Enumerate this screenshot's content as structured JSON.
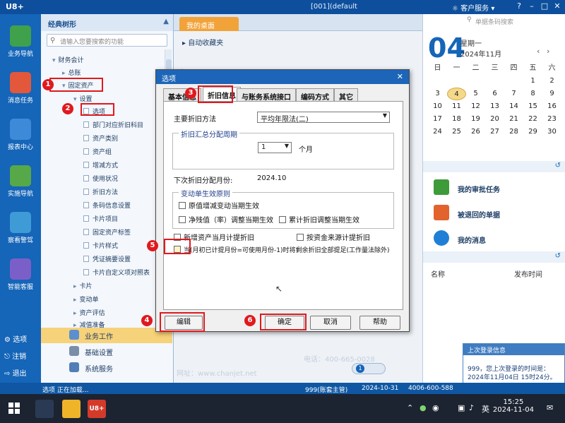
{
  "titlebar": {
    "brand": "U8+",
    "window_title": "[001](default",
    "service": "客户服务"
  },
  "rail": {
    "items": [
      {
        "label": "业务导航"
      },
      {
        "label": "消息任务"
      },
      {
        "label": "报表中心"
      },
      {
        "label": "实施导航"
      },
      {
        "label": "察看警驾"
      },
      {
        "label": "智能客服"
      }
    ],
    "bottom": [
      "选项",
      "注销",
      "退出"
    ]
  },
  "tree": {
    "title": "经典树形",
    "search_placeholder": "请输入您要搜索的功能",
    "nodes": [
      {
        "text": "财务会计"
      },
      {
        "text": "总账"
      },
      {
        "text": "固定资产"
      },
      {
        "text": "设置"
      },
      {
        "text": "选项"
      },
      {
        "text": "部门对应折旧科目"
      },
      {
        "text": "资产类别"
      },
      {
        "text": "资产组"
      },
      {
        "text": "增减方式"
      },
      {
        "text": "使用状况"
      },
      {
        "text": "折旧方法"
      },
      {
        "text": "条码信息设置"
      },
      {
        "text": "卡片项目"
      },
      {
        "text": "固定资产标签"
      },
      {
        "text": "卡片样式"
      },
      {
        "text": "凭证摘要设置"
      },
      {
        "text": "卡片自定义项对照表"
      },
      {
        "text": "卡片"
      },
      {
        "text": "变动单"
      },
      {
        "text": "资产评估"
      },
      {
        "text": "减值准备"
      }
    ],
    "tail": [
      "业务工作",
      "基础设置",
      "系统服务"
    ]
  },
  "main": {
    "tab": "我的桌面",
    "autofav": "自动收藏夹"
  },
  "right": {
    "search_placeholder": "单据条码搜索",
    "day": "04",
    "weekday": "星期一",
    "month": "2024年11月",
    "week_header": [
      "日",
      "一",
      "二",
      "三",
      "四",
      "五",
      "六"
    ],
    "weeks": [
      [
        "",
        "",
        "",
        "",
        "",
        "1",
        "2"
      ],
      [
        "3",
        "4",
        "5",
        "6",
        "7",
        "8",
        "9"
      ],
      [
        "10",
        "11",
        "12",
        "13",
        "14",
        "15",
        "16"
      ],
      [
        "17",
        "18",
        "19",
        "20",
        "21",
        "22",
        "23"
      ],
      [
        "24",
        "25",
        "26",
        "27",
        "28",
        "29",
        "30"
      ]
    ],
    "today": "4",
    "tasks": [
      "我的审批任务",
      "被退回的单据",
      "我的消息"
    ],
    "msg_col_name": "名称",
    "msg_col_time": "发布时间",
    "login_title": "上次登录信息",
    "login_text": "999，您上次登录的时间是：2024年11月04日 15时24分。"
  },
  "status": {
    "left": "选项 正在加载...",
    "user": "999(账套主管)",
    "date": "2024-10-31",
    "phone": "4006-600-588"
  },
  "taskbar": {
    "time": "15:25",
    "date": "2024-11-04",
    "lang": "英"
  },
  "dialog": {
    "title": "选项",
    "tabs": [
      "基本信息",
      "折旧信息",
      "与账务系统接口",
      "编码方式",
      "其它"
    ],
    "method_label": "主要折旧方法",
    "method_value": "平均年限法(二)",
    "cycle_group": "折旧汇总分配周期",
    "cycle_value": "1",
    "cycle_unit": "个月",
    "next_label": "下次折旧分配月份:",
    "next_value": "2024.10",
    "principle_group": "变动单生效原则",
    "chk_orig": "原值增减变动当期生效",
    "chk_net": "净残值（率）调整当期生效",
    "chk_accum": "累计折旧调整当期生效",
    "chk_new": "新增资产当月计提折旧",
    "chk_fund": "按资金来源计提折旧",
    "chk_last": "当(月初已计提月份=可使用月份-1)时将剩余折旧全部提足(工作量法除外)",
    "btn_edit": "编辑",
    "btn_ok": "确定",
    "btn_cancel": "取消",
    "btn_help": "帮助"
  },
  "watermark": [
    "电话：400-665-0028",
    "网址：www.chanjet.net"
  ],
  "colors": {
    "accent_red": "#e0191e",
    "nav_blue": "#1565b8",
    "tab_orange": "#f1a33a"
  }
}
